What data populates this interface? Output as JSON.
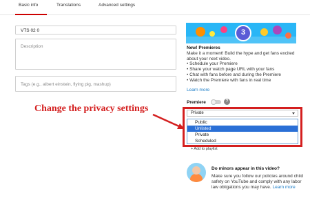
{
  "tabs": [
    {
      "label": "Basic info"
    },
    {
      "label": "Translations"
    },
    {
      "label": "Advanced settings"
    }
  ],
  "form": {
    "title_value": "VTS 02 0",
    "description_placeholder": "Description",
    "tags_placeholder": "Tags (e.g., albert einstein, flying pig, mashup)"
  },
  "promo": {
    "banner_number": "3",
    "title": "New! Premieres",
    "body": "Make it a moment! Build the hype and get fans excited about your next video.",
    "bullets": [
      "• Schedule your Premiere",
      "• Share your watch page URL with your fans",
      "• Chat with fans before and during the Premiere",
      "• Watch the Premiere with fans in real time"
    ],
    "learn_more": "Learn more"
  },
  "premiere": {
    "label": "Premiere",
    "help_glyph": "?"
  },
  "privacy": {
    "selected": "Private",
    "options": [
      "Public",
      "Unlisted",
      "Private",
      "Scheduled"
    ],
    "highlighted_option": "Unlisted"
  },
  "playlist": {
    "label": "+ Add to playlist"
  },
  "annotation": {
    "text": "Change the privacy settings",
    "color": "#d41f1f"
  },
  "minors": {
    "title": "Do minors appear in this video?",
    "body": "Make sure you follow our policies around child safety on YouTube and comply with any labor law obligations you may have.",
    "link": "Learn more"
  },
  "colors": {
    "tab_accent": "#cc0000",
    "link": "#167ac6",
    "dropdown_highlight": "#2a6fd6",
    "banner": "#29b6f6"
  },
  "icons": [
    "help-icon",
    "chevron-down-icon",
    "minors-illustration-icon"
  ]
}
